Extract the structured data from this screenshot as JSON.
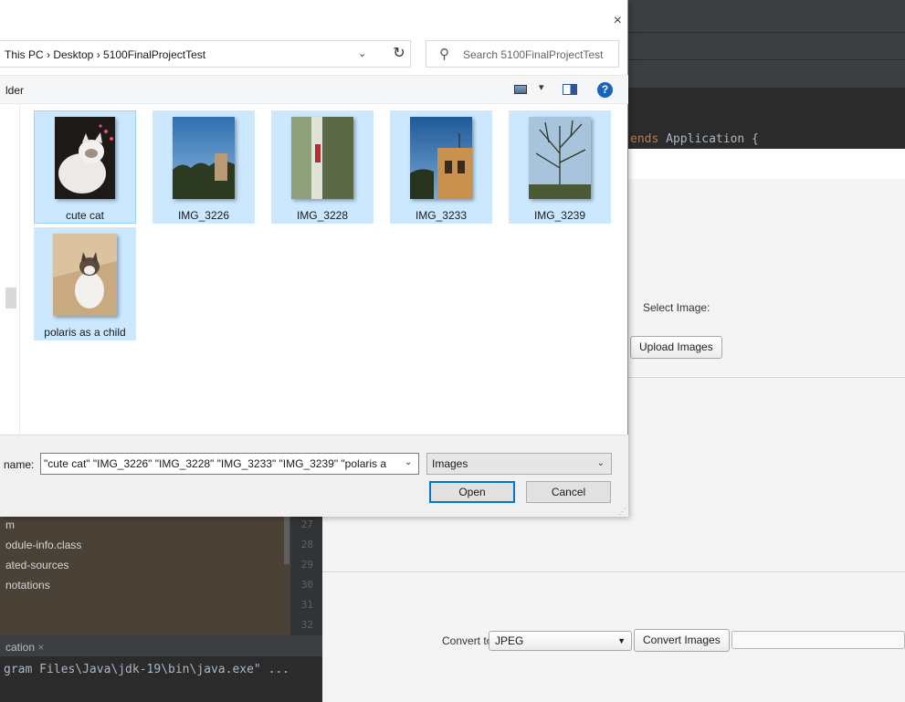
{
  "ide": {
    "code_line_keyword": "ends",
    "code_line_rest": " Application {",
    "project_items": [
      "m",
      "odule-info.class",
      "ated-sources",
      "notations"
    ],
    "line_numbers": [
      "27",
      "28",
      "29",
      "30",
      "31",
      "32"
    ],
    "run_tab": {
      "label": "cation",
      "close": "×"
    },
    "run_output": "gram Files\\Java\\jdk-19\\bin\\java.exe\" ..."
  },
  "app": {
    "select_image_label": "Select Image:",
    "upload_button": "Upload Images",
    "convert_to_label": "Convert to:",
    "format_select": {
      "value": "JPEG",
      "arrow": "▼"
    },
    "convert_button": "Convert Images"
  },
  "dialog": {
    "close_glyph": "×",
    "breadcrumb": "This PC  ›  Desktop  ›  5100FinalProjectTest",
    "address_dropdown": "⌄",
    "refresh_glyph": "↻",
    "search_placeholder": "Search 5100FinalProjectTest",
    "search_glyph": "⚲",
    "command_bar_text": "lder",
    "view_dropdown": "▾",
    "help_glyph": "?",
    "files": [
      {
        "name": "cute cat",
        "icon": "image-thumbnail-cat"
      },
      {
        "name": "IMG_3226",
        "icon": "image-thumbnail-sky"
      },
      {
        "name": "IMG_3228",
        "icon": "image-thumbnail-room"
      },
      {
        "name": "IMG_3233",
        "icon": "image-thumbnail-building"
      },
      {
        "name": "IMG_3239",
        "icon": "image-thumbnail-tree"
      },
      {
        "name": "polaris as a child",
        "icon": "image-thumbnail-cat-box"
      }
    ],
    "file_name_label": "name:",
    "file_name_value": "\"cute cat\" \"IMG_3226\" \"IMG_3228\" \"IMG_3233\" \"IMG_3239\" \"polaris a",
    "file_name_dropdown": "⌄",
    "file_type": {
      "value": "Images",
      "arrow": "⌄"
    },
    "open_button": "Open",
    "cancel_button": "Cancel",
    "resize_grip": "⋰"
  },
  "colors": {
    "selection": "#cce8ff",
    "focus_border": "#99d1ff",
    "primary_border": "#0078d7",
    "ide_dark": "#2b2b2b"
  }
}
